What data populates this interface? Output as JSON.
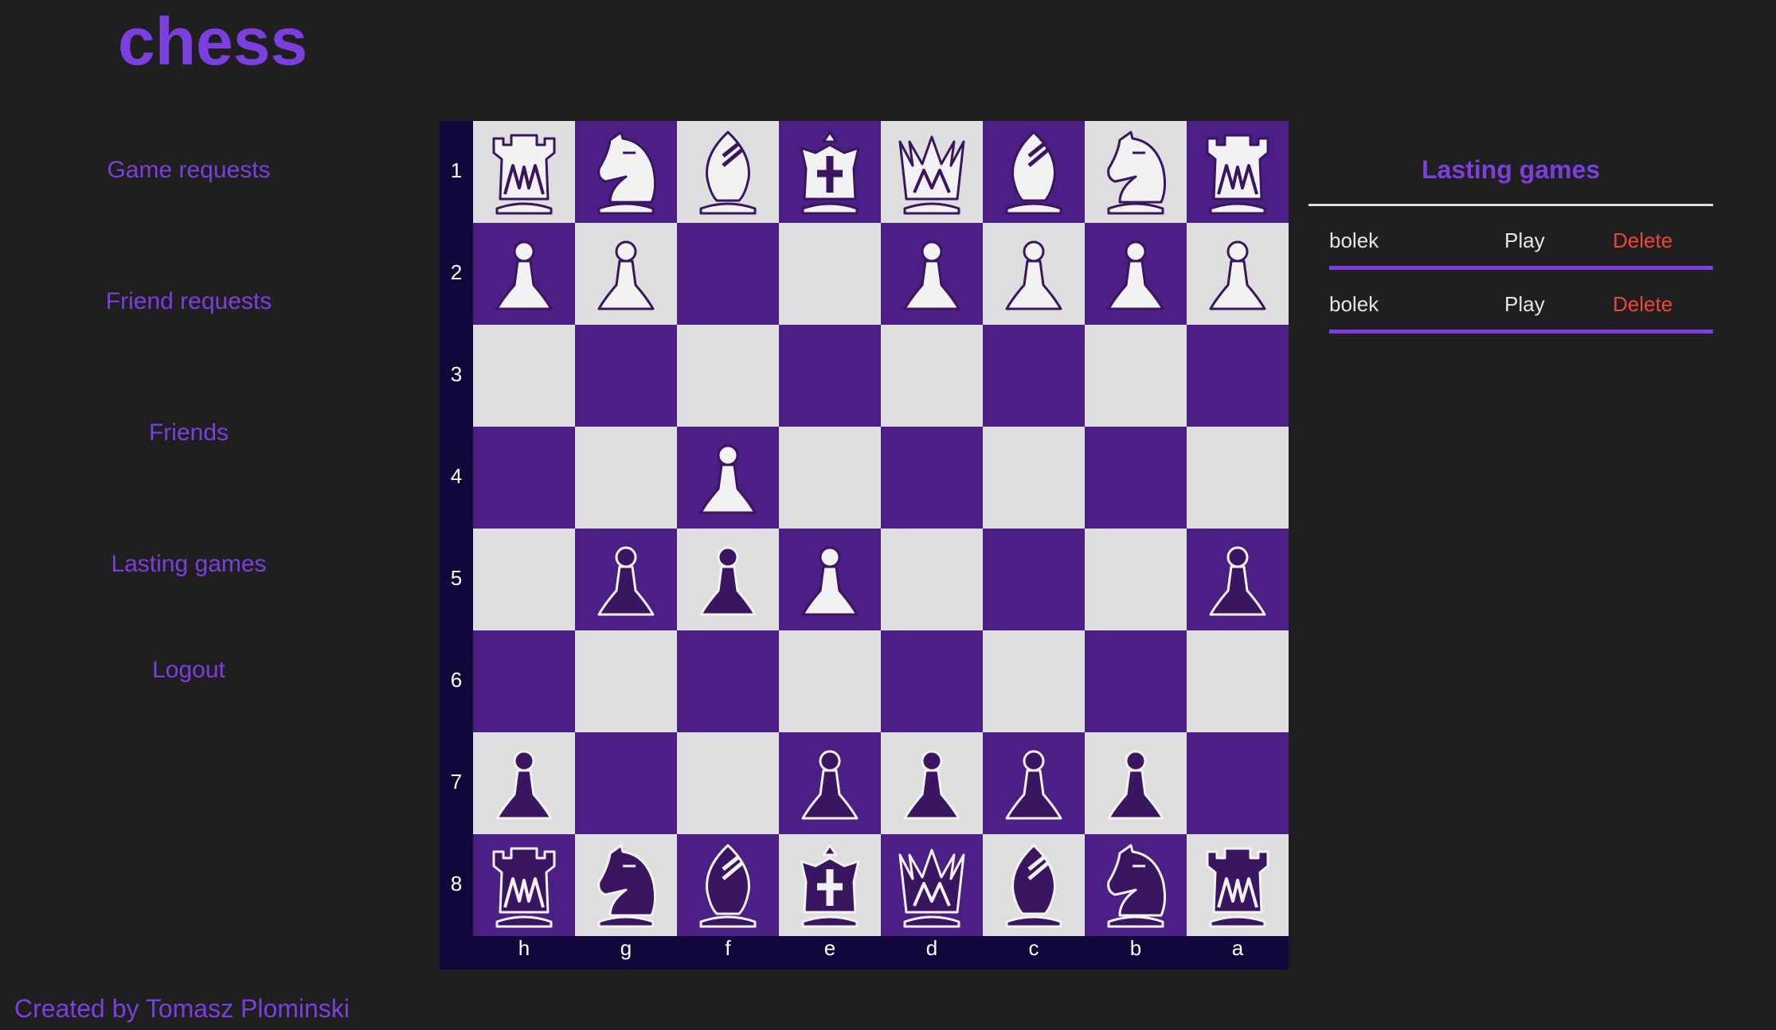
{
  "app": {
    "title": "chess"
  },
  "nav": [
    {
      "label": "Game requests",
      "name": "nav-game-requests"
    },
    {
      "label": "Friend requests",
      "name": "nav-friend-requests"
    },
    {
      "label": "Friends",
      "name": "nav-friends"
    },
    {
      "label": "Lasting games",
      "name": "nav-lasting-games"
    },
    {
      "label": "Logout",
      "name": "nav-logout"
    }
  ],
  "footer": {
    "text": "Created by Tomasz Plominski"
  },
  "board": {
    "orientation": "black-bottom",
    "files": [
      "h",
      "g",
      "f",
      "e",
      "d",
      "c",
      "b",
      "a"
    ],
    "ranks": [
      "1",
      "2",
      "3",
      "4",
      "5",
      "6",
      "7",
      "8"
    ],
    "rows": [
      [
        "wR",
        "wN",
        "wB",
        "wK",
        "wQ",
        "wB",
        "wN",
        "wR"
      ],
      [
        "wP",
        "wP",
        "",
        "",
        "wP",
        "wP",
        "wP",
        "wP"
      ],
      [
        "",
        "",
        "",
        "",
        "",
        "",
        "",
        ""
      ],
      [
        "",
        "",
        "wP",
        "",
        "",
        "",
        "",
        ""
      ],
      [
        "",
        "bP",
        "bP",
        "wP",
        "",
        "",
        "",
        "bP"
      ],
      [
        "",
        "",
        "",
        "",
        "",
        "",
        "",
        ""
      ],
      [
        "bP",
        "",
        "",
        "bP",
        "bP",
        "bP",
        "bP",
        ""
      ],
      [
        "bR",
        "bN",
        "bB",
        "bK",
        "bQ",
        "bB",
        "bN",
        "bR"
      ]
    ],
    "colors": {
      "dark": "#4b1f86",
      "light": "#dedede",
      "white_piece": "#f2f2f2",
      "black_piece": "#3a1560",
      "frame": "#12073a"
    }
  },
  "lasting_games": {
    "title": "Lasting games",
    "games": [
      {
        "player": "bolek",
        "play_label": "Play",
        "delete_label": "Delete"
      },
      {
        "player": "bolek",
        "play_label": "Play",
        "delete_label": "Delete"
      }
    ]
  },
  "colors": {
    "accent": "#7b3fe0",
    "background": "#1f1f1f",
    "danger": "#f0443a"
  }
}
